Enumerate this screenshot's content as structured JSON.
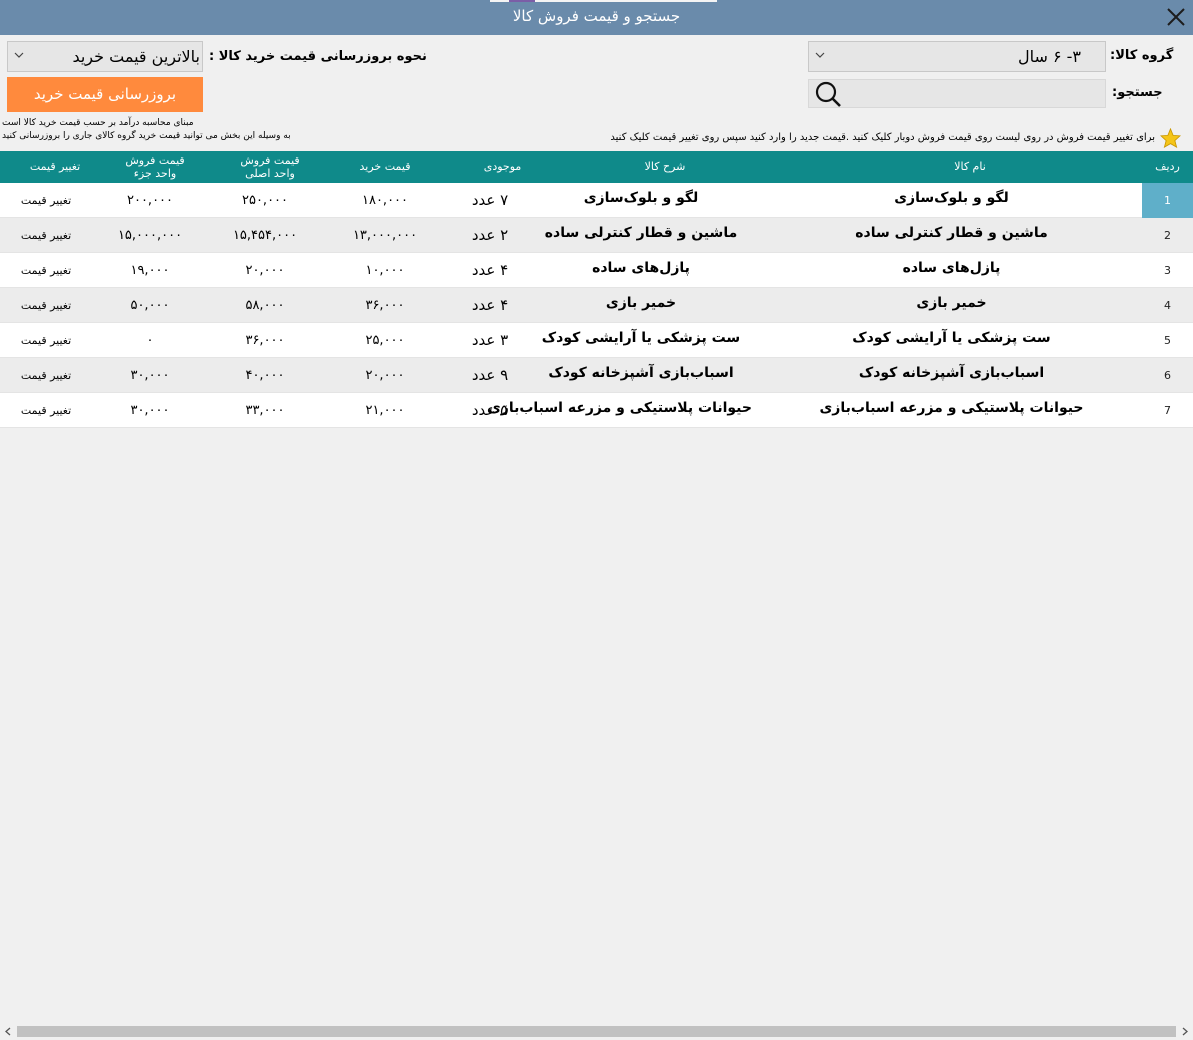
{
  "window": {
    "title": "جستجو و قیمت فروش کالا"
  },
  "filters": {
    "group_label": "گروه کالا:",
    "group_value": "۳- ۶ سال",
    "search_label": "جستجو:",
    "search_value": "",
    "update_method_label": "نحوه بروزرسانی قیمت خرید کالا :",
    "update_method_value": "بالاترین قیمت خرید",
    "update_button": "بروزرسانی قیمت خرید",
    "note_line1": "مبنای محاسبه درآمد بر حسب قیمت خرید کالا است",
    "note_line2": "به وسیله این بخش می توانید قیمت خرید گروه کالای جاری را بروزرسانی کنید",
    "hint": "برای تغییر قیمت فروش در روی لیست روی قیمت فروش دوبار کلیک کنید .قیمت جدید را وارد کنید سپس روی تغییر قیمت کلیک کنید"
  },
  "grid": {
    "headers": {
      "row": "ردیف",
      "name": "نام کالا",
      "desc": "شرح کالا",
      "stock": "موجودی",
      "buy": "قیمت خرید",
      "sale_main_1": "قیمت فروش",
      "sale_main_2": "واحد اصلی",
      "sale_part_1": "قیمت فروش",
      "sale_part_2": "واحد جزء",
      "change": "تغییر قیمت"
    },
    "rows": [
      {
        "idx": "1",
        "name": "لگو و بلوک‌سازی",
        "desc": "لگو و بلوک‌سازی",
        "stock": "۷ عدد",
        "buy": "۱۸۰,۰۰۰",
        "sale": "۲۵۰,۰۰۰",
        "sale_part": "۲۰۰,۰۰۰",
        "action": "تغییر قیمت"
      },
      {
        "idx": "2",
        "name": "ماشین و قطار کنترلی ساده",
        "desc": "ماشین و قطار کنترلی ساده",
        "stock": "۲ عدد",
        "buy": "۱۳,۰۰۰,۰۰۰",
        "sale": "۱۵,۴۵۴,۰۰۰",
        "sale_part": "۱۵,۰۰۰,۰۰۰",
        "action": "تغییر قیمت"
      },
      {
        "idx": "3",
        "name": "پازل‌های ساده",
        "desc": "پازل‌های ساده",
        "stock": "۴ عدد",
        "buy": "۱۰,۰۰۰",
        "sale": "۲۰,۰۰۰",
        "sale_part": "۱۹,۰۰۰",
        "action": "تغییر قیمت"
      },
      {
        "idx": "4",
        "name": "خمیر بازی",
        "desc": "خمیر بازی",
        "stock": "۴ عدد",
        "buy": "۳۶,۰۰۰",
        "sale": "۵۸,۰۰۰",
        "sale_part": "۵۰,۰۰۰",
        "action": "تغییر قیمت"
      },
      {
        "idx": "5",
        "name": "ست پزشکی یا آرایشی کودک",
        "desc": "ست پزشکی یا آرایشی کودک",
        "stock": "۳ عدد",
        "buy": "۲۵,۰۰۰",
        "sale": "۳۶,۰۰۰",
        "sale_part": "۰",
        "action": "تغییر قیمت"
      },
      {
        "idx": "6",
        "name": "اسباب‌بازی آشپزخانه کودک",
        "desc": "اسباب‌بازی آشپزخانه کودک",
        "stock": "۹ عدد",
        "buy": "۲۰,۰۰۰",
        "sale": "۴۰,۰۰۰",
        "sale_part": "۳۰,۰۰۰",
        "action": "تغییر قیمت"
      },
      {
        "idx": "7",
        "name": "حیوانات پلاستیکی و مزرعه اسباب‌بازی",
        "desc": "حیوانات پلاستیکی و مزرعه اسباب‌بازی",
        "stock": "۵ عدد",
        "buy": "۲۱,۰۰۰",
        "sale": "۳۳,۰۰۰",
        "sale_part": "۳۰,۰۰۰",
        "action": "تغییر قیمت"
      }
    ]
  },
  "colors": {
    "titlebar": "#6a8bab",
    "header": "#0f8a8a",
    "selected_row_index": "#5fafc9",
    "update_button": "#ff8a3d"
  }
}
